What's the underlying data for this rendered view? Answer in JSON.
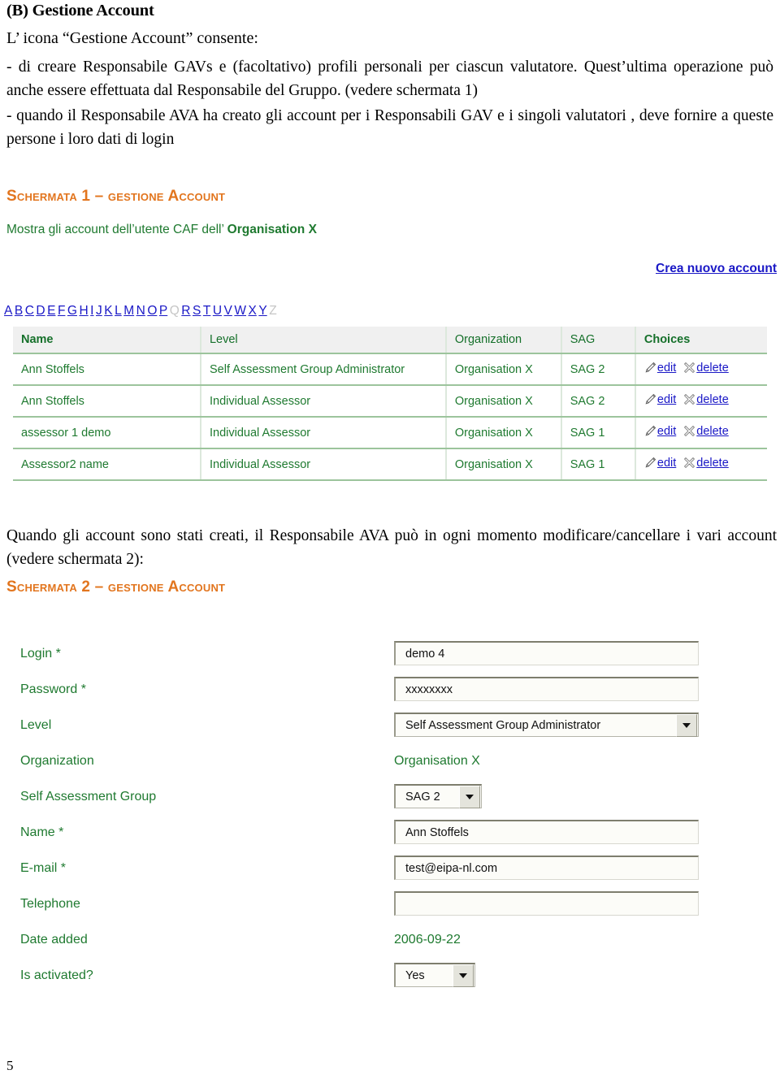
{
  "document": {
    "heading": "(B) Gestione Account",
    "intro_line": "L’ icona “Gestione Account” consente:",
    "paragraph_1": "-  di creare Responsabile GAVs e (facoltativo) profili personali per ciascun valutatore.   Quest’ultima operazione può anche essere effettuata dal Responsabile del Gruppo. (vedere schermata 1)",
    "paragraph_2": "- quando il Responsabile AVA ha creato gli account per i Responsabili GAV e i singoli valutatori , deve fornire a  queste persone i loro dati di login",
    "paragraph_3": "Quando gli account sono stati creati, il Responsabile AVA  può in ogni momento modificare/cancellare i vari account (vedere schermata 2):",
    "page_number": "5"
  },
  "captions": {
    "schermata_1": "Schermata 1 – gestione Account",
    "schermata_2": "Schermata 2 – gestione Account"
  },
  "screen1": {
    "mostra_prefix": "Mostra gli account dell’utente  CAF dell’ ",
    "mostra_org": "Organisation X",
    "create_account_link": "Crea nuovo account",
    "alphabet": [
      {
        "letter": "A",
        "enabled": true
      },
      {
        "letter": "B",
        "enabled": true
      },
      {
        "letter": "C",
        "enabled": true
      },
      {
        "letter": "D",
        "enabled": true
      },
      {
        "letter": "E",
        "enabled": true
      },
      {
        "letter": "F",
        "enabled": true
      },
      {
        "letter": "G",
        "enabled": true
      },
      {
        "letter": "H",
        "enabled": true
      },
      {
        "letter": "I",
        "enabled": true
      },
      {
        "letter": "J",
        "enabled": true
      },
      {
        "letter": "K",
        "enabled": true
      },
      {
        "letter": "L",
        "enabled": true
      },
      {
        "letter": "M",
        "enabled": true
      },
      {
        "letter": "N",
        "enabled": true
      },
      {
        "letter": "O",
        "enabled": true
      },
      {
        "letter": "P",
        "enabled": true
      },
      {
        "letter": "Q",
        "enabled": false
      },
      {
        "letter": "R",
        "enabled": true
      },
      {
        "letter": "S",
        "enabled": true
      },
      {
        "letter": "T",
        "enabled": true
      },
      {
        "letter": "U",
        "enabled": true
      },
      {
        "letter": "V",
        "enabled": true
      },
      {
        "letter": "W",
        "enabled": true
      },
      {
        "letter": "X",
        "enabled": true
      },
      {
        "letter": "Y",
        "enabled": true
      },
      {
        "letter": "Z",
        "enabled": false
      }
    ],
    "table": {
      "columns": [
        {
          "label": "Name",
          "bold": true
        },
        {
          "label": "Level",
          "bold": false
        },
        {
          "label": "Organization",
          "bold": false
        },
        {
          "label": "SAG",
          "bold": false
        },
        {
          "label": "Choices",
          "bold": true
        }
      ],
      "rows": [
        {
          "name": "Ann Stoffels",
          "level": "Self Assessment Group Administrator",
          "organization": "Organisation X",
          "sag": "SAG 2",
          "edit_label": "edit",
          "delete_label": "delete"
        },
        {
          "name": "Ann Stoffels",
          "level": "Individual Assessor",
          "organization": "Organisation X",
          "sag": "SAG 2",
          "edit_label": "edit",
          "delete_label": "delete"
        },
        {
          "name": "assessor 1 demo",
          "level": "Individual Assessor",
          "organization": "Organisation X",
          "sag": "SAG 1",
          "edit_label": "edit",
          "delete_label": "delete"
        },
        {
          "name": "Assessor2 name",
          "level": "Individual Assessor",
          "organization": "Organisation X",
          "sag": "SAG 1",
          "edit_label": "edit",
          "delete_label": "delete"
        }
      ]
    }
  },
  "screen2": {
    "fields": {
      "login": {
        "label": "Login *",
        "value": "demo 4"
      },
      "password": {
        "label": "Password *",
        "value": "xxxxxxxx"
      },
      "level": {
        "label": "Level",
        "value": "Self Assessment Group Administrator"
      },
      "organization": {
        "label": "Organization",
        "value": "Organisation X"
      },
      "sag": {
        "label": "Self Assessment Group",
        "value": "SAG 2"
      },
      "name": {
        "label": "Name *",
        "value": "Ann Stoffels"
      },
      "email": {
        "label": "E-mail *",
        "value": "test@eipa-nl.com"
      },
      "telephone": {
        "label": "Telephone",
        "value": ""
      },
      "date_added": {
        "label": "Date added",
        "value": "2006-09-22"
      },
      "is_activated": {
        "label": "Is activated?",
        "value": "Yes"
      }
    }
  },
  "colors": {
    "green": "#1F7A30",
    "orange": "#E2751E",
    "link_blue": "#1A18C6",
    "disabled_gray": "#C6C6C6",
    "header_bg": "#F0F0F0"
  }
}
